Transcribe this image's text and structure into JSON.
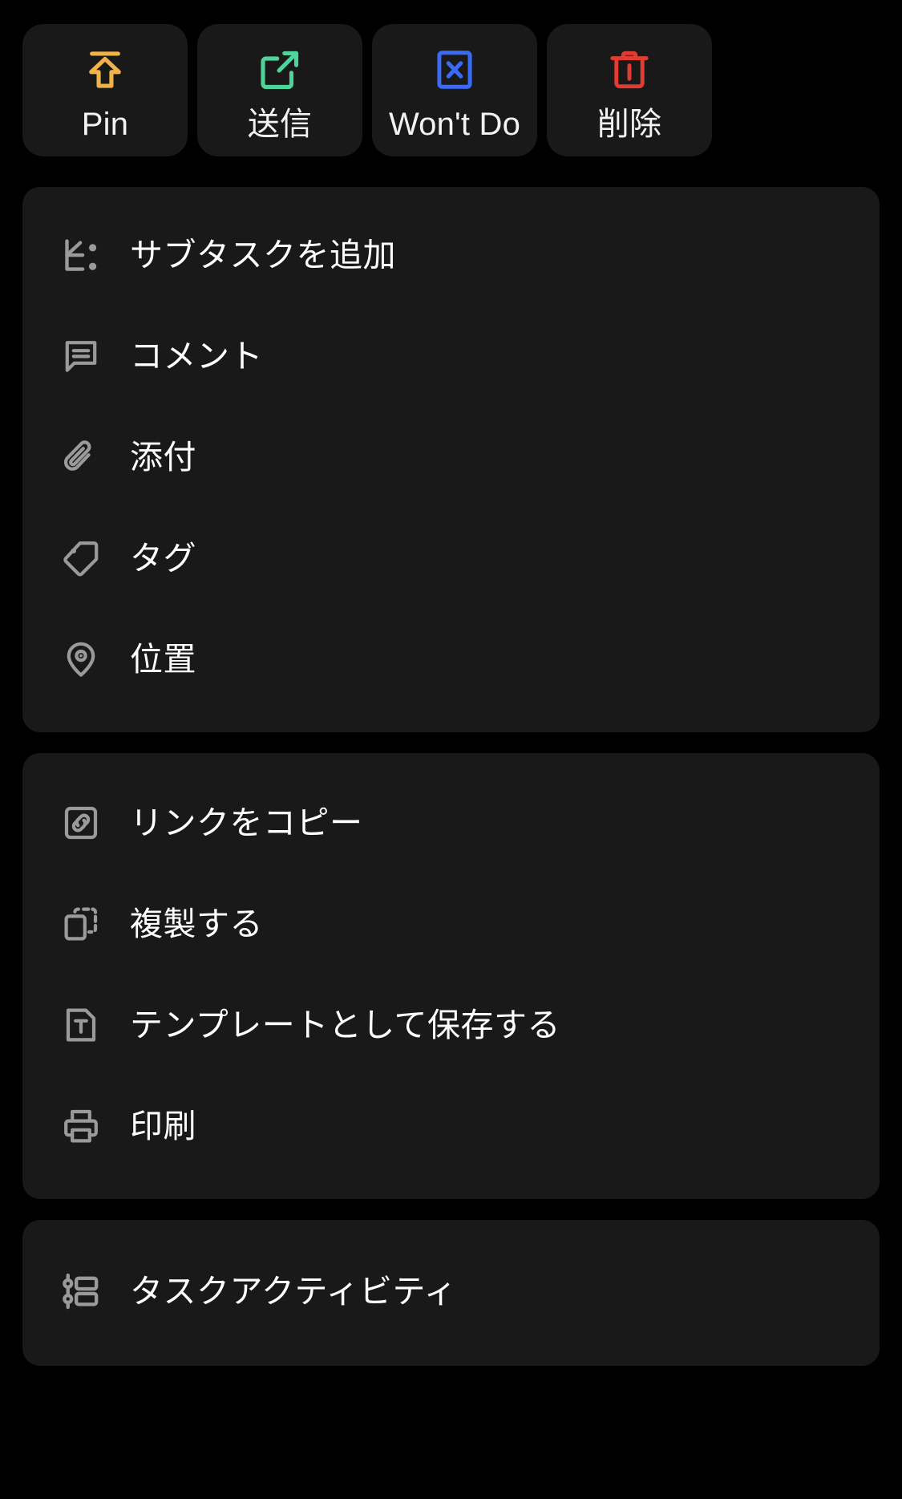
{
  "theme": {
    "page_background": "#000000",
    "card_background": "#191919",
    "label_color": "#ffffff",
    "icon_color": "#9a9a9a"
  },
  "quick_actions": [
    {
      "label": "Pin",
      "icon": "pin-to-top-icon",
      "color": "#F0B34A"
    },
    {
      "label": "送信",
      "icon": "external-link-icon",
      "color": "#4FD39B"
    },
    {
      "label": "Won't Do",
      "icon": "x-square-icon",
      "color": "#3B6BF5"
    },
    {
      "label": "削除",
      "icon": "trash-icon",
      "color": "#E03C32"
    }
  ],
  "groups": [
    {
      "name": "task-content-group",
      "items": [
        {
          "label": "サブタスクを追加",
          "icon": "subtask-icon"
        },
        {
          "label": "コメント",
          "icon": "comment-icon"
        },
        {
          "label": "添付",
          "icon": "paperclip-icon"
        },
        {
          "label": "タグ",
          "icon": "tag-icon"
        },
        {
          "label": "位置",
          "icon": "location-pin-icon"
        }
      ]
    },
    {
      "name": "task-actions-group",
      "items": [
        {
          "label": "リンクをコピー",
          "icon": "copy-link-icon"
        },
        {
          "label": "複製する",
          "icon": "duplicate-icon"
        },
        {
          "label": "テンプレートとして保存する",
          "icon": "save-template-icon"
        },
        {
          "label": "印刷",
          "icon": "printer-icon"
        }
      ]
    },
    {
      "name": "task-activity-group",
      "items": [
        {
          "label": "タスクアクティビティ",
          "icon": "activity-list-icon"
        }
      ]
    }
  ]
}
